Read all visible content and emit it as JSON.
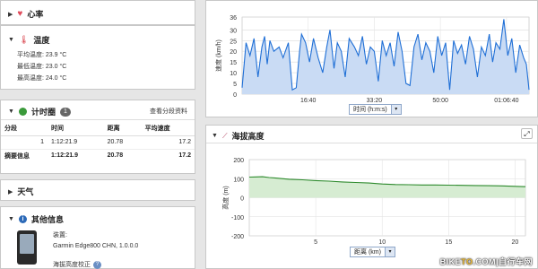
{
  "left": {
    "heart": {
      "title": "心率"
    },
    "temp": {
      "title": "温度",
      "rows": [
        {
          "label": "平均温度:",
          "value": "23.9 °C"
        },
        {
          "label": "最低温度:",
          "value": "23.0 °C"
        },
        {
          "label": "最高温度:",
          "value": "24.0 °C"
        }
      ]
    },
    "laps": {
      "title": "计时圈",
      "count": "1",
      "link": "查看分段资料",
      "headers": [
        "分段",
        "时间",
        "距离",
        "平均速度"
      ],
      "rows": [
        [
          "1",
          "1:12:21.9",
          "20.78",
          "17.2"
        ],
        [
          "摘要信息",
          "1:12:21.9",
          "20.78",
          "17.2"
        ]
      ]
    },
    "weather": {
      "title": "天气"
    },
    "other": {
      "title": "其他信息",
      "device_label": "装置:",
      "device_value": "Garmin Edge800 CHN, 1.0.0.0",
      "elev_label": "海拔高度校正"
    }
  },
  "speed_panel": {
    "axis_select": "时间 (h:m:s)",
    "select_arrow": "▾"
  },
  "elev_panel": {
    "title": "海拔高度",
    "axis_select": "距离 (km)",
    "select_arrow": "▾",
    "expand_glyph": "⤢"
  },
  "watermark": {
    "domain_prefix": "BIKE",
    "domain_mid": "TO",
    "domain_suffix": ".COM|自行车网"
  },
  "colors": {
    "speed_line": "#1f6fd6",
    "speed_fill": "#c9dbf4",
    "elev_line": "#2d8a2d",
    "elev_fill": "#d6ecd2"
  },
  "chart_data": [
    {
      "type": "line",
      "ylabel": "速度 (km/h)",
      "xlabel": "时间 (h:m:s)",
      "ylim": [
        0,
        36
      ],
      "yticks": [
        0,
        5,
        10,
        15,
        20,
        25,
        30,
        36
      ],
      "xlim": [
        0,
        4341
      ],
      "xticks": [
        {
          "v": 1000,
          "label": "16:40"
        },
        {
          "v": 2000,
          "label": "33:20"
        },
        {
          "v": 3000,
          "label": "50:00"
        },
        {
          "v": 4000,
          "label": "01:06:40"
        }
      ],
      "series": [
        {
          "x": [
            0,
            60,
            120,
            180,
            240,
            300,
            340,
            380,
            420,
            480,
            560,
            620,
            700,
            760,
            820,
            870,
            900,
            960,
            1020,
            1080,
            1150,
            1220,
            1280,
            1330,
            1390,
            1440,
            1500,
            1560,
            1620,
            1700,
            1760,
            1820,
            1880,
            1940,
            2000,
            2060,
            2120,
            2180,
            2240,
            2300,
            2360,
            2420,
            2480,
            2540,
            2600,
            2660,
            2720,
            2780,
            2840,
            2900,
            2960,
            3020,
            3080,
            3140,
            3200,
            3260,
            3320,
            3380,
            3440,
            3500,
            3560,
            3620,
            3680,
            3740,
            3790,
            3840,
            3900,
            3960,
            4020,
            4080,
            4140,
            4200,
            4260,
            4300,
            4341
          ],
          "y": [
            3,
            24,
            18,
            26,
            8,
            22,
            27,
            14,
            25,
            20,
            22,
            17,
            24,
            2,
            3,
            20,
            28,
            24,
            15,
            26,
            17,
            10,
            22,
            30,
            12,
            24,
            20,
            8,
            26,
            22,
            18,
            27,
            14,
            22,
            20,
            6,
            25,
            18,
            24,
            13,
            29,
            20,
            5,
            4,
            22,
            28,
            16,
            24,
            20,
            10,
            27,
            18,
            24,
            2,
            25,
            19,
            23,
            14,
            27,
            21,
            8,
            22,
            18,
            28,
            15,
            24,
            21,
            35,
            18,
            26,
            10,
            23,
            17,
            14,
            2
          ]
        }
      ]
    },
    {
      "type": "area",
      "ylabel": "高度 (m)",
      "xlabel": "距离 (km)",
      "ylim": [
        -200,
        200
      ],
      "yticks": [
        -200,
        -100,
        0,
        100,
        200
      ],
      "xlim": [
        0,
        20.78
      ],
      "xticks": [
        5,
        10,
        15,
        20
      ],
      "series": [
        {
          "x": [
            0,
            0.5,
            1,
            1.5,
            2,
            3,
            4,
            5,
            6,
            7,
            8,
            9,
            10,
            11,
            12,
            13,
            14,
            15,
            16,
            17,
            18,
            19,
            20,
            20.78
          ],
          "y": [
            108,
            109,
            110,
            106,
            103,
            97,
            94,
            90,
            87,
            83,
            80,
            77,
            72,
            69,
            68,
            67,
            67,
            66,
            65,
            64,
            63,
            62,
            60,
            58
          ]
        }
      ]
    }
  ]
}
